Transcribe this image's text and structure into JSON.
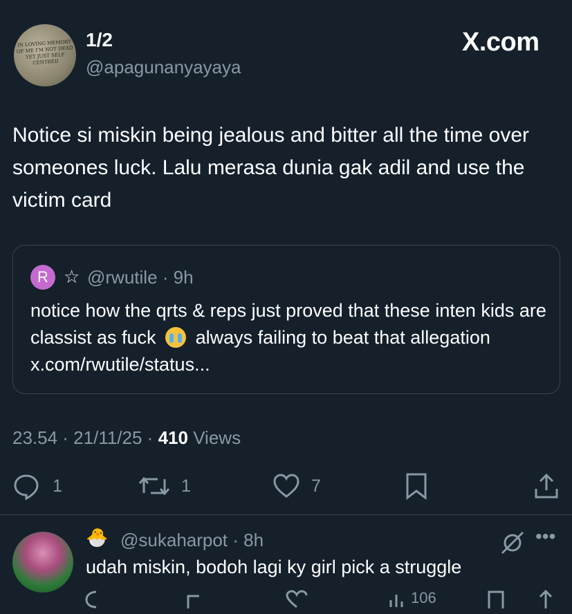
{
  "post": {
    "label": "1/2",
    "handle": "@apagunanyayaya",
    "avatar_text": "IN LOVING MEMORY OF ME I'M NOT DEAD YET JUST SELF CENTRED",
    "brand": "X.com",
    "text": "Notice si miskin being jealous and bitter all the time over someones luck. Lalu merasa dunia gak adil and use the victim card"
  },
  "quote": {
    "avatar_letter": "R",
    "star": "☆",
    "handle": "@rwutile",
    "time": "· 9h",
    "text_before": "notice how the qrts & reps just proved that these inten kids are classist as fuck",
    "text_after": "always failing to beat that allegation x.com/rwutile/status..."
  },
  "meta": {
    "time": "23.54 · 21/11/25 ·",
    "views_count": "410",
    "views_label": "Views"
  },
  "actions": {
    "replies": "1",
    "reposts": "1",
    "likes": "7"
  },
  "reply": {
    "emoji": "🐣",
    "handle": "@sukaharpot",
    "time": "· 8h",
    "text": "udah miskin, bodoh lagi ky girl pick a struggle",
    "views": "106"
  }
}
